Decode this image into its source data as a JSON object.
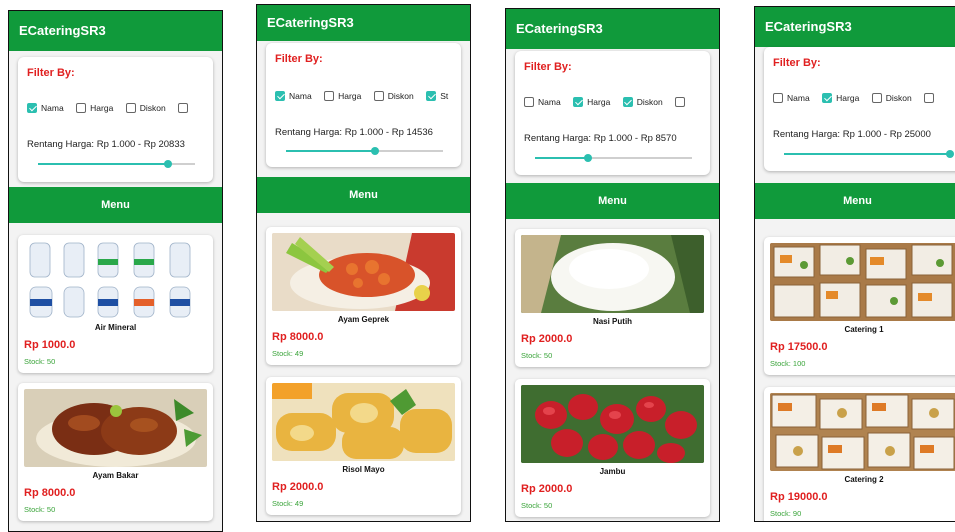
{
  "phones": [
    {
      "app_title": "ECateringSR3",
      "filter_title": "Filter By:",
      "checkboxes": [
        {
          "label": "Nama",
          "checked": true
        },
        {
          "label": "Harga",
          "checked": false
        },
        {
          "label": "Diskon",
          "checked": false
        },
        {
          "label": "",
          "checked": false
        }
      ],
      "price_range": "Rentang Harga: Rp 1.000 - Rp 20833",
      "slider_fraction": 0.83,
      "menu_label": "Menu",
      "products": [
        {
          "name": "Air Mineral",
          "price": "Rp 1000.0",
          "stock": "Stock: 50"
        },
        {
          "name": "Ayam Bakar",
          "price": "Rp 8000.0",
          "stock": "Stock: 50"
        }
      ]
    },
    {
      "app_title": "ECateringSR3",
      "filter_title": "Filter By:",
      "checkboxes": [
        {
          "label": "Nama",
          "checked": true
        },
        {
          "label": "Harga",
          "checked": false
        },
        {
          "label": "Diskon",
          "checked": false
        },
        {
          "label": "St",
          "checked": true
        }
      ],
      "price_range": "Rentang Harga: Rp 1.000 - Rp 14536",
      "slider_fraction": 0.57,
      "menu_label": "Menu",
      "products": [
        {
          "name": "Ayam Geprek",
          "price": "Rp 8000.0",
          "stock": "Stock: 49"
        },
        {
          "name": "Risol Mayo",
          "price": "Rp 2000.0",
          "stock": "Stock: 49"
        }
      ]
    },
    {
      "app_title": "ECateringSR3",
      "filter_title": "Filter By:",
      "checkboxes": [
        {
          "label": "Nama",
          "checked": false
        },
        {
          "label": "Harga",
          "checked": true
        },
        {
          "label": "Diskon",
          "checked": true
        },
        {
          "label": "",
          "checked": false
        }
      ],
      "price_range": "Rentang Harga: Rp 1.000 - Rp 8570",
      "slider_fraction": 0.34,
      "menu_label": "Menu",
      "products": [
        {
          "name": "Nasi Putih",
          "price": "Rp 2000.0",
          "stock": "Stock: 50"
        },
        {
          "name": "Jambu",
          "price": "Rp 2000.0",
          "stock": "Stock: 50"
        }
      ]
    },
    {
      "app_title": "ECateringSR3",
      "filter_title": "Filter By:",
      "checkboxes": [
        {
          "label": "Nama",
          "checked": false
        },
        {
          "label": "Harga",
          "checked": true
        },
        {
          "label": "Diskon",
          "checked": false
        },
        {
          "label": "",
          "checked": false
        }
      ],
      "price_range": "Rentang Harga: Rp 1.000 - Rp 25000",
      "slider_fraction": 1.0,
      "menu_label": "Menu",
      "products": [
        {
          "name": "Catering 1",
          "price": "Rp 17500.0",
          "stock": "Stock: 100"
        },
        {
          "name": "Catering 2",
          "price": "Rp 19000.0",
          "stock": "Stock: 90"
        }
      ]
    }
  ],
  "colors": {
    "app_green": "#109a3b",
    "price_red": "#e02020",
    "stock_green": "#3aa43a",
    "accent_teal": "#2bbfb0"
  },
  "product_images": [
    "water-bottles-image",
    "grilled-chicken-image",
    "fried-chicken-sambal-image",
    "risol-mayo-image",
    "white-rice-image",
    "rose-apple-image",
    "catering-box-image",
    "catering-box-image"
  ]
}
